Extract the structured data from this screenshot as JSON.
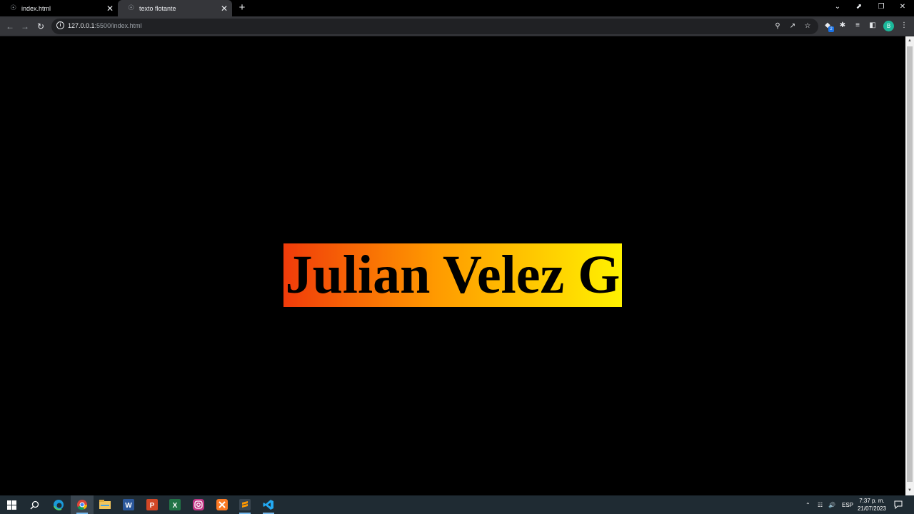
{
  "browser": {
    "tabs": [
      {
        "title": "index.html",
        "active": false
      },
      {
        "title": "texto flotante",
        "active": true
      }
    ],
    "new_tab_label": "+",
    "url_host": "127.0.0.1",
    "url_rest": ":5500/index.html"
  },
  "page": {
    "floating_text": "Julian Velez G",
    "gradient_colors": [
      "#f03b0a",
      "#ff9a00",
      "#fff200"
    ],
    "background_color": "#000000"
  },
  "taskbar": {
    "apps": [
      "start-icon",
      "search-icon",
      "edge-icon",
      "chrome-icon",
      "file-explorer-icon",
      "word-icon",
      "powerpoint-icon",
      "excel-icon",
      "instagram-icon",
      "xampp-icon",
      "sublime-icon",
      "vscode-icon"
    ],
    "tray_language": "ESP",
    "clock_time": "7:37 p. m.",
    "clock_date": "21/07/2023"
  },
  "profile_initial": "B",
  "extension_badge": "2"
}
